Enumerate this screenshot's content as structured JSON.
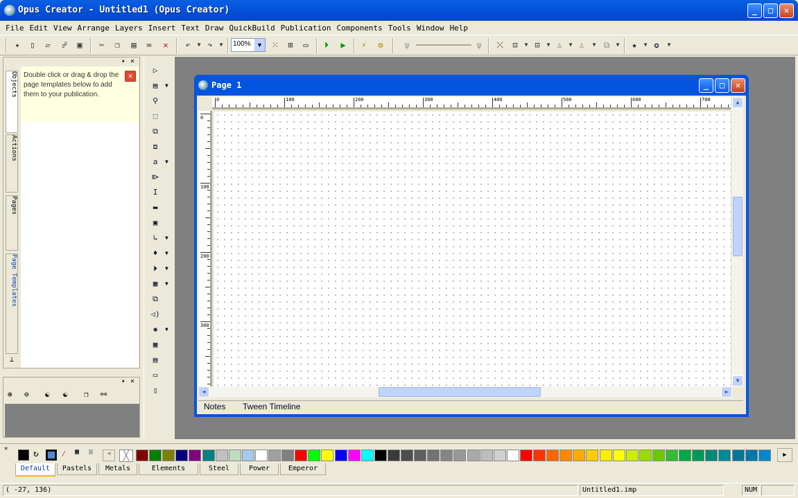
{
  "app": {
    "title": "Opus Creator - Untitled1 (Opus Creator)"
  },
  "menu": [
    "File",
    "Edit",
    "View",
    "Arrange",
    "Layers",
    "Insert",
    "Text",
    "Draw",
    "QuickBuild",
    "Publication",
    "Components",
    "Tools",
    "Window",
    "Help"
  ],
  "toolbar": {
    "zoom": "100%"
  },
  "sidepanel": {
    "tabs": [
      "Objects",
      "Actions",
      "Pages",
      "Page Templates"
    ],
    "info_text": "Double click or drag & drop the page templates below to add them to your publication."
  },
  "page_window": {
    "title": "Page 1",
    "ruler_h": [
      "0",
      "100",
      "200",
      "300",
      "400",
      "500",
      "600",
      "700"
    ],
    "ruler_v": [
      "0",
      "100",
      "200",
      "300"
    ],
    "tabs": [
      "Notes",
      "Tween Timeline"
    ]
  },
  "palette": {
    "tabs": [
      "Default",
      "Pastels",
      "Metals",
      "Elements",
      "Steel",
      "Power",
      "Emperor"
    ],
    "colors": [
      "#800000",
      "#008000",
      "#808000",
      "#000080",
      "#800080",
      "#008080",
      "#c0c0c0",
      "#c0dcc0",
      "#a6caf0",
      "#ffffff",
      "#a0a0a4",
      "#808080",
      "#ff0000",
      "#00ff00",
      "#ffff00",
      "#0000ff",
      "#ff00ff",
      "#00ffff",
      "#000000",
      "#3a3a3a",
      "#4d4d4d",
      "#5f5f5f",
      "#727272",
      "#858585",
      "#989898",
      "#aaaaaa",
      "#bdbdbd",
      "#d0d0d0",
      "#ffffff",
      "#ff0000",
      "#ff3300",
      "#ff6600",
      "#ff8800",
      "#ffaa00",
      "#ffcc00",
      "#ffee00",
      "#ffff00",
      "#ccee00",
      "#99dd00",
      "#66cc00",
      "#33bb33",
      "#00aa44",
      "#009955",
      "#008877",
      "#008899",
      "#007799",
      "#0077aa",
      "#0088cc"
    ]
  },
  "status": {
    "coords": "( -27,  136)",
    "file": "Untitled1.imp",
    "num": "NUM"
  }
}
